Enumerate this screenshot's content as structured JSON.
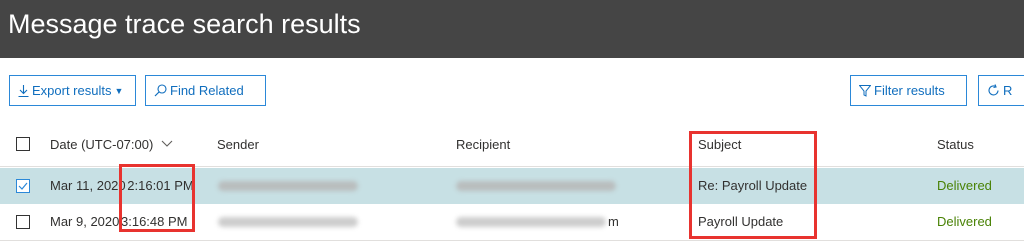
{
  "page": {
    "title": "Message trace search results"
  },
  "toolbar": {
    "export_label": "Export results",
    "find_related_label": "Find Related",
    "filter_label": "Filter results",
    "refresh_label": "R"
  },
  "columns": {
    "date": "Date (UTC-07:00)",
    "sender": "Sender",
    "recipient": "Recipient",
    "subject": "Subject",
    "status": "Status"
  },
  "rows": [
    {
      "date": "Mar 11, 2020",
      "time": "2:16:01 PM",
      "recipient_tail": "",
      "subject": "Re: Payroll Update",
      "status": "Delivered",
      "selected": true
    },
    {
      "date": "Mar 9, 2020",
      "time": "3:16:48 PM",
      "recipient_tail": "m",
      "subject": "Payroll Update",
      "status": "Delivered",
      "selected": false
    }
  ],
  "colors": {
    "header_bg": "#454545",
    "accent": "#106ebe",
    "selected_row": "#c7e0e4",
    "delivered": "#498205",
    "highlight": "#e8332f"
  },
  "icons": [
    "download-icon",
    "search-icon",
    "chevron-down-icon",
    "filter-icon",
    "refresh-icon",
    "check-icon"
  ]
}
